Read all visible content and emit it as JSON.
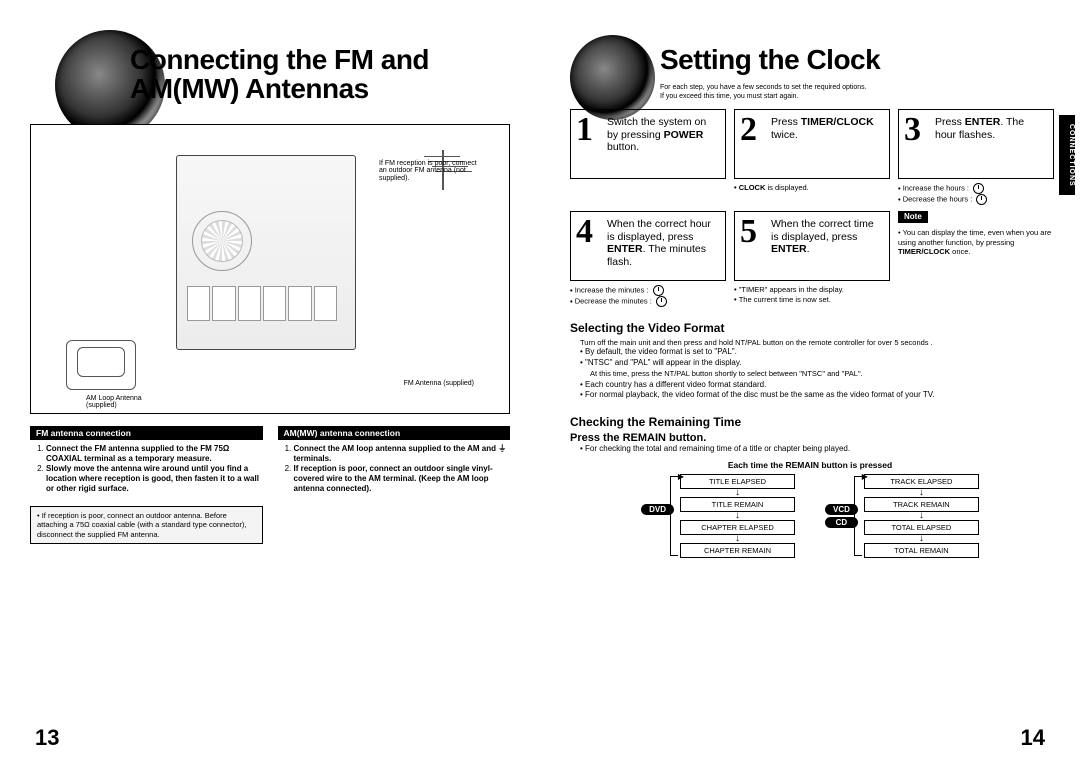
{
  "left": {
    "title": "Connecting the FM and AM(MW) Antennas",
    "diagram": {
      "fm_note": "If FM reception is poor, connect an outdoor FM antenna (not supplied).",
      "fm_antenna_label": "FM Antenna (supplied)",
      "am_loop_label": "AM Loop Antenna (supplied)"
    },
    "fm": {
      "header": "FM antenna connection",
      "step1": "Connect the FM antenna supplied to the FM 75Ω COAXIAL terminal as a temporary measure.",
      "step2": "Slowly move the antenna wire around until you find a location where reception is good, then fasten it to a wall or other rigid surface.",
      "note": "If reception is poor, connect an outdoor antenna. Before attaching a 75Ω coaxial cable (with a standard type connector), disconnect the supplied FM antenna."
    },
    "am": {
      "header": "AM(MW) antenna connection",
      "step1": "Connect the AM loop antenna supplied to the AM and ⏚ terminals.",
      "step2": "If reception is poor, connect an outdoor single vinyl-covered wire to the AM terminal. (Keep the AM loop antenna connected)."
    },
    "page_number": "13"
  },
  "right": {
    "title": "Setting the Clock",
    "sub1": "For each step, you have a few seconds to set the required options.",
    "sub2": "If you exceed this time, you must start again.",
    "side_tab": "CONNECTIONS",
    "steps": {
      "1": {
        "pre": "Switch the system on by pressing ",
        "bold": "POWER",
        "post": " button."
      },
      "2": {
        "pre": "Press ",
        "bold": "TIMER/CLOCK",
        "post": " twice.",
        "below": "CLOCK is displayed."
      },
      "3": {
        "pre": "Press ",
        "bold": "ENTER",
        "post": ". The hour flashes.",
        "inc": "Increase the hours :",
        "dec": "Decrease the hours :"
      },
      "4": {
        "pre": "When the correct hour is displayed, press ",
        "bold": "ENTER",
        "post": ". The minutes flash.",
        "inc": "Increase the minutes :",
        "dec": "Decrease the minutes :"
      },
      "5": {
        "pre": "When the correct time is displayed, press ",
        "bold": "ENTER",
        "post": ".",
        "b1": "\"TIMER\" appears in the display.",
        "b2": "The current time is now set."
      },
      "note_label": "Note",
      "note_text": "You can display the time, even when you are using another function, by pressing",
      "note_bold": "TIMER/CLOCK",
      "note_post": " once."
    },
    "video": {
      "header": "Selecting the Video Format",
      "intro": "Turn off the main unit and then press and hold NT/PAL button on the remote controller for over 5 seconds .",
      "b1": "By default, the video format is set to \"PAL\".",
      "b2": "\"NTSC\" and \"PAL\" will appear in the display.",
      "b2b": "At this time, press the NT/PAL button shortly to select between \"NTSC\" and \"PAL\".",
      "b3": "Each country has a different video format standard.",
      "b4": "For normal playback, the video format of the disc must be the same as the video format of your TV."
    },
    "remain": {
      "header": "Checking the Remaining Time",
      "press": "Press the REMAIN button.",
      "desc": "For checking the total and remaining time of a title or chapter being played.",
      "each": "Each time the REMAIN button is pressed",
      "dvd": "DVD",
      "vcd": "VCD",
      "cd": "CD",
      "col1": [
        "TITLE ELAPSED",
        "TITLE REMAIN",
        "CHAPTER ELAPSED",
        "CHAPTER REMAIN"
      ],
      "col2": [
        "TRACK ELAPSED",
        "TRACK REMAIN",
        "TOTAL ELAPSED",
        "TOTAL REMAIN"
      ]
    },
    "page_number": "14"
  }
}
